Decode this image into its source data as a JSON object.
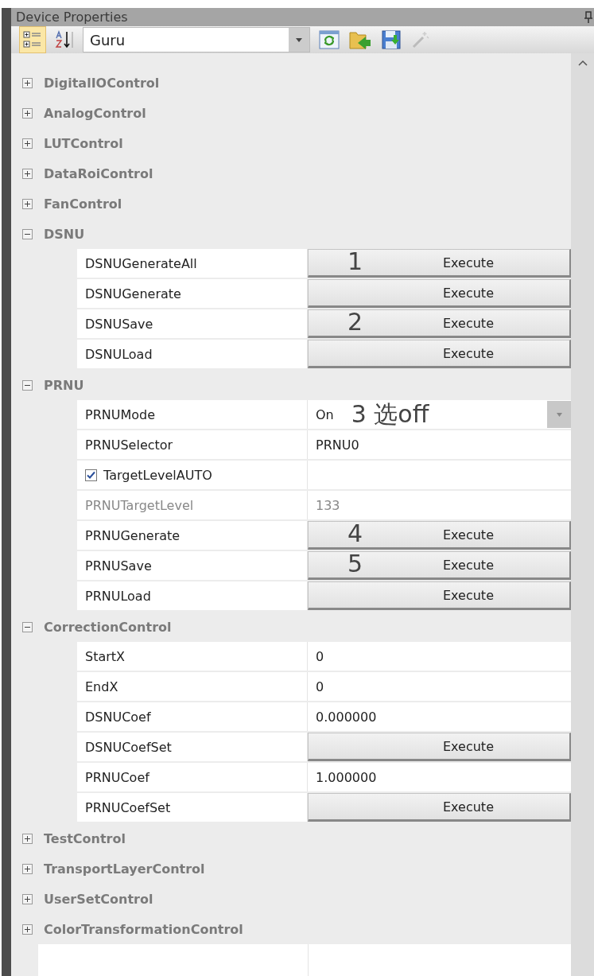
{
  "panel": {
    "title": "Device Properties"
  },
  "toolbar": {
    "view_buttons": [
      {
        "kind": "categorized",
        "selected": true
      },
      {
        "kind": "alphabetical",
        "selected": false
      }
    ],
    "profile": "Guru"
  },
  "categories": [
    {
      "name": "DigitalIOControl",
      "expanded": false
    },
    {
      "name": "AnalogControl",
      "expanded": false
    },
    {
      "name": "LUTControl",
      "expanded": false
    },
    {
      "name": "DataRoiControl",
      "expanded": false
    },
    {
      "name": "FanControl",
      "expanded": false
    },
    {
      "name": "DSNU",
      "expanded": true,
      "properties": [
        {
          "name": "DSNUGenerateAll",
          "kind": "execute",
          "value": "Execute",
          "note": "1"
        },
        {
          "name": "DSNUGenerate",
          "kind": "execute",
          "value": "Execute"
        },
        {
          "name": "DSNUSave",
          "kind": "execute",
          "value": "Execute",
          "note": "2"
        },
        {
          "name": "DSNULoad",
          "kind": "execute",
          "value": "Execute"
        }
      ]
    },
    {
      "name": "PRNU",
      "expanded": true,
      "properties": [
        {
          "name": "PRNUMode",
          "kind": "dropdown",
          "value": "On",
          "note": "3 选off"
        },
        {
          "name": "PRNUSelector",
          "kind": "text",
          "value": "PRNU0"
        },
        {
          "name": "TargetLevelAUTO",
          "kind": "checkbox",
          "checked": true
        },
        {
          "name": "PRNUTargetLevel",
          "kind": "text",
          "value": "133",
          "disabled": true
        },
        {
          "name": "PRNUGenerate",
          "kind": "execute",
          "value": "Execute",
          "note": "4"
        },
        {
          "name": "PRNUSave",
          "kind": "execute",
          "value": "Execute",
          "note": "5"
        },
        {
          "name": "PRNULoad",
          "kind": "execute",
          "value": "Execute"
        }
      ]
    },
    {
      "name": "CorrectionControl",
      "expanded": true,
      "properties": [
        {
          "name": "StartX",
          "kind": "text",
          "value": "0"
        },
        {
          "name": "EndX",
          "kind": "text",
          "value": "0"
        },
        {
          "name": "DSNUCoef",
          "kind": "text",
          "value": "0.000000"
        },
        {
          "name": "DSNUCoefSet",
          "kind": "execute",
          "value": "Execute"
        },
        {
          "name": "PRNUCoef",
          "kind": "text",
          "value": "1.000000"
        },
        {
          "name": "PRNUCoefSet",
          "kind": "execute",
          "value": "Execute"
        }
      ]
    },
    {
      "name": "TestControl",
      "expanded": false
    },
    {
      "name": "TransportLayerControl",
      "expanded": false
    },
    {
      "name": "UserSetControl",
      "expanded": false
    },
    {
      "name": "ColorTransformationControl",
      "expanded": false
    }
  ]
}
